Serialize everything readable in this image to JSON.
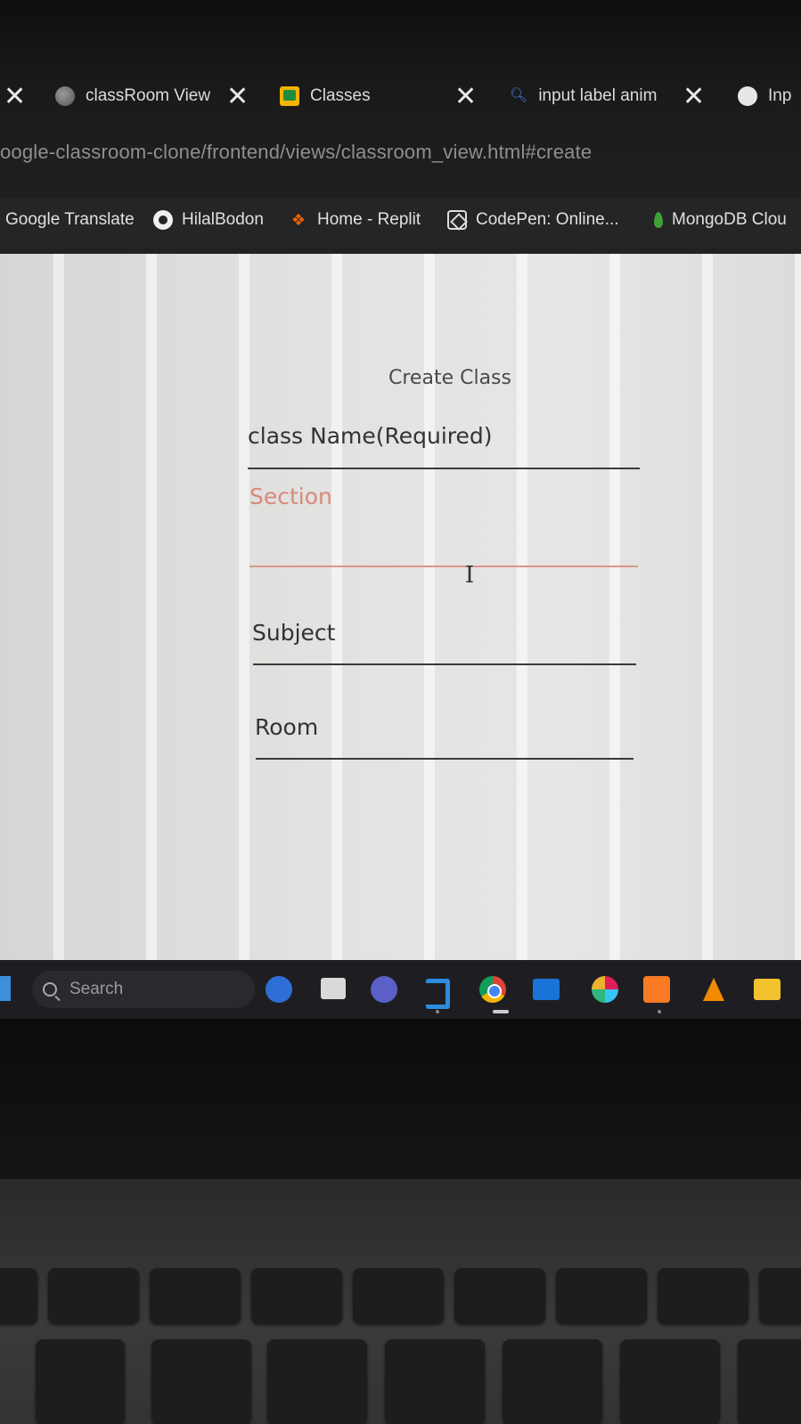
{
  "tabs": [
    {
      "title": "classRoom View",
      "icon": "globe-icon"
    },
    {
      "title": "Classes",
      "icon": "google-classroom-icon"
    },
    {
      "title": "input label anim",
      "icon": "search-icon"
    },
    {
      "title": "Inp",
      "icon": "globe-icon"
    }
  ],
  "address_bar": {
    "url": "oogle-classroom-clone/frontend/views/classroom_view.html#create"
  },
  "bookmarks": [
    {
      "label": "Google Translate"
    },
    {
      "label": "HilalBodon",
      "icon": "github-icon"
    },
    {
      "label": "Home - Replit",
      "icon": "replit-icon"
    },
    {
      "label": "CodePen: Online...",
      "icon": "codepen-icon"
    },
    {
      "label": "MongoDB Clou",
      "icon": "mongodb-icon"
    }
  ],
  "form": {
    "title": "Create Class",
    "fields": [
      {
        "label": "class Name(Required)",
        "active": false
      },
      {
        "label": "Section",
        "active": true
      },
      {
        "label": "Subject",
        "active": false
      },
      {
        "label": "Room",
        "active": false
      }
    ]
  },
  "taskbar": {
    "search_placeholder": "Search",
    "icons": [
      "bing-icon",
      "file-explorer-icon",
      "teams-meet-icon",
      "vscode-icon",
      "chrome-icon",
      "mail-icon",
      "slack-icon",
      "xampp-icon",
      "vlc-icon",
      "folder-icon"
    ]
  },
  "colors": {
    "active_field": "#d78a78",
    "page_background": "#e2e2e0"
  }
}
